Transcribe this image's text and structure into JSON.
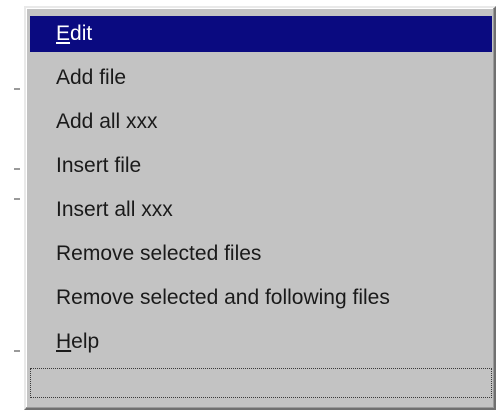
{
  "menu": {
    "items": [
      {
        "label": "Edit",
        "accel": "E",
        "rest": "dit",
        "selected": true
      },
      {
        "label": "Add file"
      },
      {
        "label": "Add all xxx"
      },
      {
        "label": "Insert file"
      },
      {
        "label": "Insert all xxx"
      },
      {
        "label": "Remove selected files"
      },
      {
        "label": "Remove selected and following files"
      },
      {
        "label": "Help",
        "accel": "H",
        "rest": "elp"
      }
    ]
  },
  "colors": {
    "menu_bg": "#c3c3c3",
    "selection_bg": "#0a0a80",
    "selection_text": "#ffffff",
    "text": "#1a1a1a"
  }
}
